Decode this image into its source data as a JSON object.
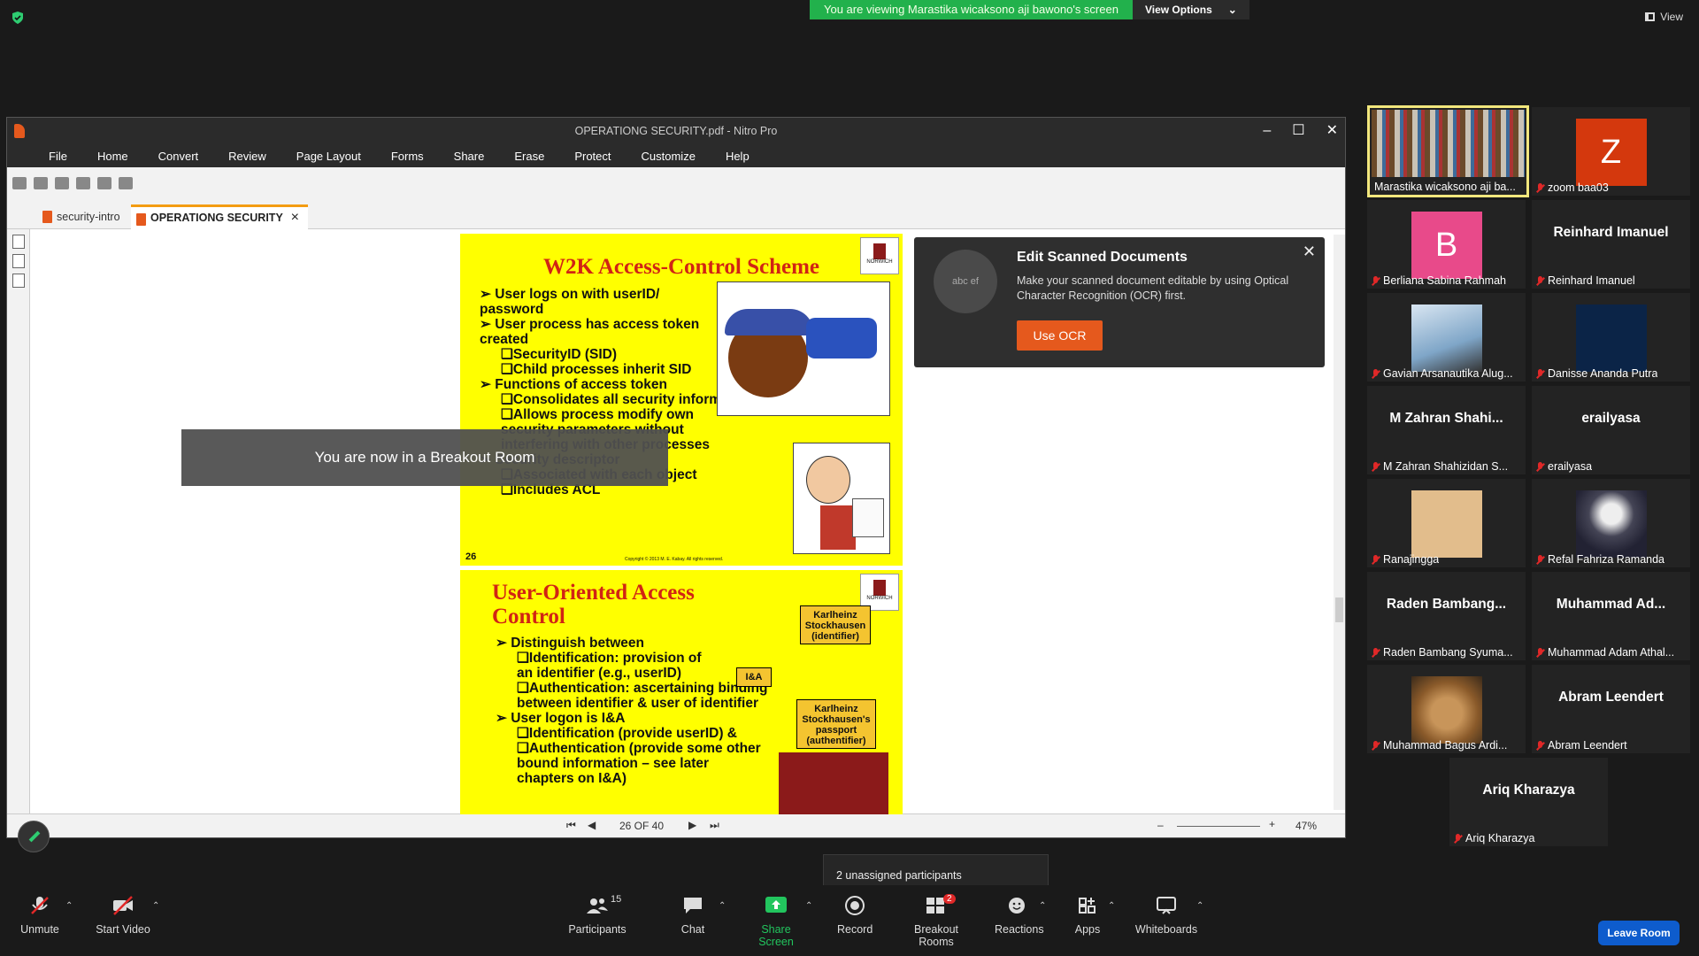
{
  "banner": {
    "text": "You are viewing Marastika wicaksono aji bawono's screen",
    "options": "View Options"
  },
  "view": "View",
  "nitro": {
    "title": "OPERATIONG SECURITY.pdf - Nitro Pro",
    "menu": [
      "File",
      "Home",
      "Convert",
      "Review",
      "Page Layout",
      "Forms",
      "Share",
      "Erase",
      "Protect",
      "Customize",
      "Help"
    ],
    "tabs": [
      "security-intro",
      "OPERATIONG SECURITY"
    ],
    "page": "26 OF 40",
    "zoom": "47%"
  },
  "slide1": {
    "title": "W2K Access-Control Scheme",
    "lines": [
      {
        "t": "➢ User logs on with userID/ password",
        "sub": false
      },
      {
        "t": "➢ User process has access token created",
        "sub": false
      },
      {
        "t": "❑SecurityID (SID)",
        "sub": true
      },
      {
        "t": "❑Child processes inherit SID",
        "sub": true
      },
      {
        "t": "➢ Functions of access token",
        "sub": false
      },
      {
        "t": "❑Consolidates all security information for fast validation",
        "sub": true
      },
      {
        "t": "❑Allows process modify own security parameters without interfering with other processes",
        "sub": true
      },
      {
        "t": "➢ Security descriptor",
        "sub": false
      },
      {
        "t": "❑Associated with each object",
        "sub": true
      },
      {
        "t": "❑Includes ACL",
        "sub": true
      }
    ],
    "number": "26",
    "copyright": "Copyright © 2013 M. E. Kabay. All rights reserved.",
    "crest": "NORWICH"
  },
  "slide2": {
    "title": "User-Oriented Access Control",
    "lines": [
      {
        "t": "➢ Distinguish between",
        "sub": false
      },
      {
        "t": "❑Identification: provision of an identifier (e.g., userID)",
        "sub": true
      },
      {
        "t": "❑Authentication: ascertaining binding between identifier & user of identifier",
        "sub": true
      },
      {
        "t": "➢ User logon is I&A",
        "sub": false
      },
      {
        "t": "❑Identification (provide userID) &",
        "sub": true
      },
      {
        "t": "❑Authentication (provide some other bound information – see later chapters on I&A)",
        "sub": true
      }
    ],
    "box_id": "Karlheinz Stockhausen (identifier)",
    "box_auth": "Karlheinz Stockhausen's passport (authentifier)",
    "ia": "I&A",
    "crest": "NORWICH"
  },
  "ocr": {
    "title": "Edit Scanned Documents",
    "desc": "Make your scanned document editable by using Optical Character Recognition (OCR) first.",
    "button": "Use OCR",
    "icon_text": "abc ef"
  },
  "toast": "You are now in a Breakout Room",
  "gallery": [
    {
      "name": "Marastika wicaksono aji ba...",
      "big": "",
      "active": true
    },
    {
      "name": "zoom baa03",
      "big": "",
      "letter": "Z",
      "color": "#d4380d"
    },
    {
      "name": "Berliana Sabina Rahmah",
      "big": "",
      "letter": "B",
      "color": "#e84a8a"
    },
    {
      "name": "Reinhard Imanuel",
      "big": "Reinhard Imanuel"
    },
    {
      "name": "Gavian Arsanautika Alug...",
      "big": ""
    },
    {
      "name": "Danisse Ananda Putra",
      "big": ""
    },
    {
      "name": "M Zahran Shahizidan S...",
      "big": "M Zahran Shahi..."
    },
    {
      "name": "erailyasa",
      "big": "erailyasa"
    },
    {
      "name": "Ranajingga",
      "big": ""
    },
    {
      "name": "Refal Fahriza Ramanda",
      "big": ""
    },
    {
      "name": "Raden Bambang Syuma...",
      "big": "Raden Bambang..."
    },
    {
      "name": "Muhammad Adam Athal...",
      "big": "Muhammad Ad..."
    },
    {
      "name": "Muhammad Bagus Ardi...",
      "big": ""
    },
    {
      "name": "Abram Leendert",
      "big": "Abram Leendert"
    },
    {
      "name": "Ariq Kharazya",
      "big": "Ariq Kharazya"
    }
  ],
  "unassigned": "2 unassigned participants",
  "toolbar": {
    "unmute": "Unmute",
    "video": "Start Video",
    "participants": "Participants",
    "participants_count": "15",
    "chat": "Chat",
    "share": "Share Screen",
    "record": "Record",
    "breakout": "Breakout Rooms",
    "breakout_badge": "2",
    "reactions": "Reactions",
    "apps": "Apps",
    "whiteboards": "Whiteboards",
    "leave": "Leave Room"
  }
}
